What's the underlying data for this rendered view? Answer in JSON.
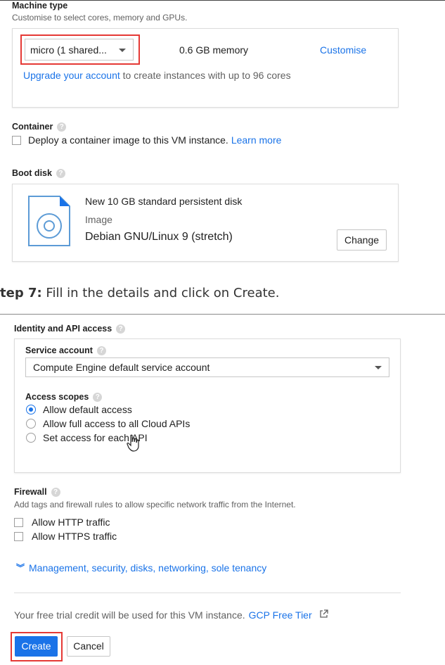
{
  "machine": {
    "title": "Machine type",
    "subtitle": "Customise to select cores, memory and GPUs.",
    "select_value": "micro (1 shared...",
    "memory": "0.6 GB memory",
    "customise": "Customise",
    "upgrade_link": "Upgrade your account",
    "upgrade_rest": " to create instances with up to 96 cores"
  },
  "container": {
    "title": "Container",
    "checkbox_label": "Deploy a container image to this VM instance.",
    "learn_more": "Learn more"
  },
  "boot_disk": {
    "title": "Boot disk",
    "disk_name": "New 10 GB standard persistent disk",
    "image_label": "Image",
    "image_name": "Debian GNU/Linux 9 (stretch)",
    "change_button": "Change"
  },
  "step": {
    "bold": "tep 7:",
    "rest": " Fill in the details and click on Create."
  },
  "identity": {
    "title": "Identity and API access",
    "service_account_label": "Service account",
    "service_account_value": "Compute Engine default service account",
    "access_scopes_label": "Access scopes",
    "scopes": [
      {
        "label": "Allow default access",
        "selected": true
      },
      {
        "label": "Allow full access to all Cloud APIs",
        "selected": false
      },
      {
        "label": "Set access for each API",
        "selected": false
      }
    ]
  },
  "firewall": {
    "title": "Firewall",
    "subtitle": "Add tags and firewall rules to allow specific network traffic from the Internet.",
    "http": "Allow HTTP traffic",
    "https": "Allow HTTPS traffic"
  },
  "management_link": "Management, security, disks, networking, sole tenancy",
  "free_trial": {
    "text": "Your free trial credit will be used for this VM instance.",
    "link": "GCP Free Tier"
  },
  "actions": {
    "create": "Create",
    "cancel": "Cancel"
  },
  "colors": {
    "accent": "#1a73e8",
    "highlight": "#e53935"
  }
}
